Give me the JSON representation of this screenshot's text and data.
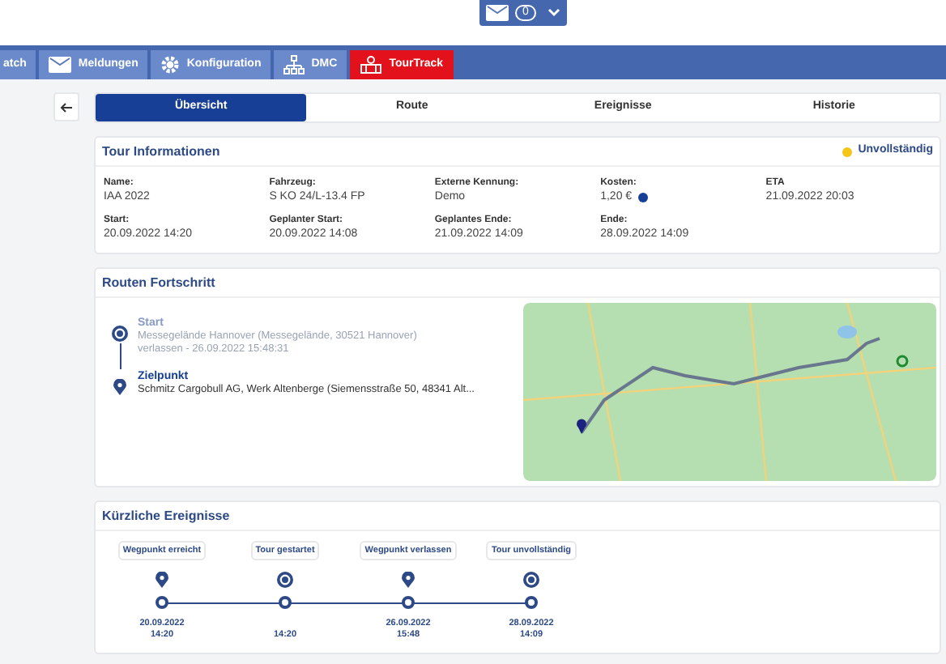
{
  "mail_button": {
    "count": "0"
  },
  "nav_tabs": [
    {
      "label": "atch",
      "kind": "none",
      "selected": false
    },
    {
      "label": "Meldungen",
      "kind": "mail",
      "selected": false
    },
    {
      "label": "Konfiguration",
      "kind": "gear",
      "selected": false
    },
    {
      "label": "DMC",
      "kind": "network",
      "selected": false
    },
    {
      "label": "TourTrack",
      "kind": "tour",
      "selected": true
    }
  ],
  "tabs": [
    {
      "label": "Übersicht",
      "selected": true
    },
    {
      "label": "Route",
      "selected": false
    },
    {
      "label": "Ereignisse",
      "selected": false
    },
    {
      "label": "Historie",
      "selected": false
    }
  ],
  "tour_info": {
    "title": "Tour Informationen",
    "status": "Unvollständig",
    "fields": [
      {
        "label": "Name:",
        "value": "IAA 2022"
      },
      {
        "label": "Fahrzeug:",
        "value": "S KO 24/L-13.4 FP"
      },
      {
        "label": "Externe Kennung:",
        "value": "Demo"
      },
      {
        "label": "Kosten:",
        "value": "1,20 €",
        "help": true
      },
      {
        "label": "ETA",
        "value": "21.09.2022 20:03"
      },
      {
        "label": "Start:",
        "value": "20.09.2022 14:20"
      },
      {
        "label": "Geplanter Start:",
        "value": "20.09.2022 14:08"
      },
      {
        "label": "Geplantes Ende:",
        "value": "21.09.2022 14:09"
      },
      {
        "label": "Ende:",
        "value": "28.09.2022 14:09"
      }
    ]
  },
  "route_progress": {
    "title": "Routen Fortschritt",
    "stops": [
      {
        "kind": "start",
        "label": "Start",
        "address": "Messegelände Hannover (Messegelände, 30521 Hannover)",
        "note": "verlassen - 26.09.2022 15:48:31",
        "done": true
      },
      {
        "kind": "destination",
        "label": "Zielpunkt",
        "address": "Schmitz Cargobull AG, Werk Altenberge (Siemensstraße 50, 48341 Alt...",
        "done": false
      }
    ]
  },
  "recent_events": {
    "title": "Kürzliche Ereignisse",
    "events": [
      {
        "label": "Wegpunkt erreicht",
        "kind": "waypoint",
        "date": "20.09.2022",
        "time": "14:20"
      },
      {
        "label": "Tour gestartet",
        "kind": "tour",
        "time": "14:20"
      },
      {
        "label": "Wegpunkt verlassen",
        "kind": "waypoint",
        "date": "26.09.2022",
        "time": "15:48"
      },
      {
        "label": "Tour unvollständig",
        "kind": "tour",
        "date": "28.09.2022",
        "time": "14:09"
      }
    ]
  }
}
